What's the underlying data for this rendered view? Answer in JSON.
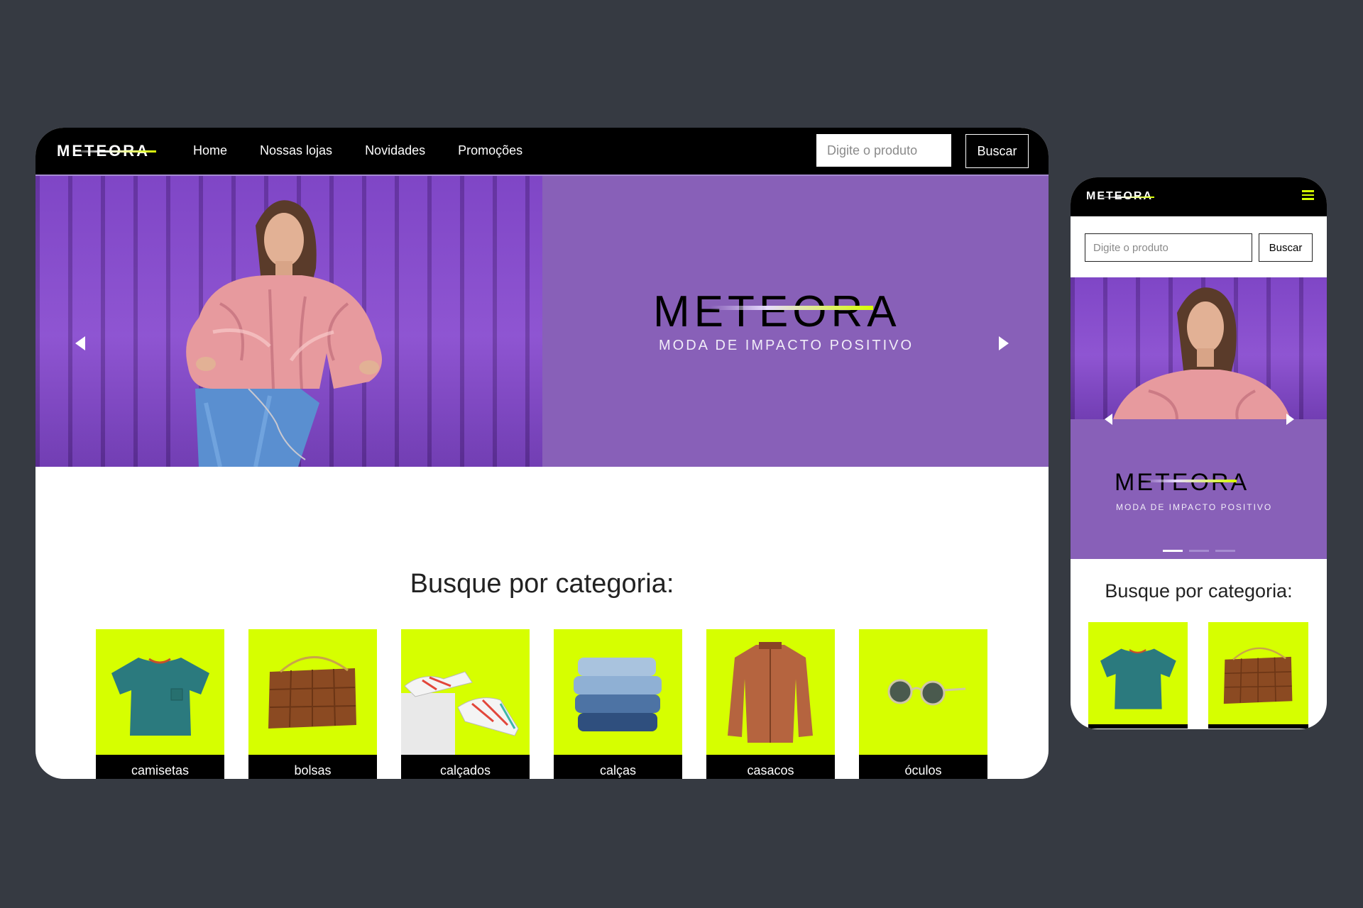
{
  "brand": {
    "name": "METEORA",
    "tagline": "MODA DE IMPACTO POSITIVO",
    "accent": "#d6ff00",
    "purple": "#8860b8",
    "header_bg": "#000000",
    "backdrop": "#363a42"
  },
  "desktop": {
    "nav": [
      "Home",
      "Nossas lojas",
      "Novidades",
      "Promoções"
    ],
    "search": {
      "placeholder": "Digite o produto",
      "button": "Buscar"
    },
    "category_title": "Busque por categoria:",
    "categories": [
      "camisetas",
      "bolsas",
      "calçados",
      "calças",
      "casacos",
      "óculos"
    ]
  },
  "mobile": {
    "search": {
      "placeholder": "Digite o produto",
      "button": "Buscar"
    },
    "category_title": "Busque por categoria:",
    "carousel_slides": 3,
    "active_slide": 1
  },
  "icons": [
    "menu-icon",
    "arrow-left-icon",
    "arrow-right-icon"
  ]
}
